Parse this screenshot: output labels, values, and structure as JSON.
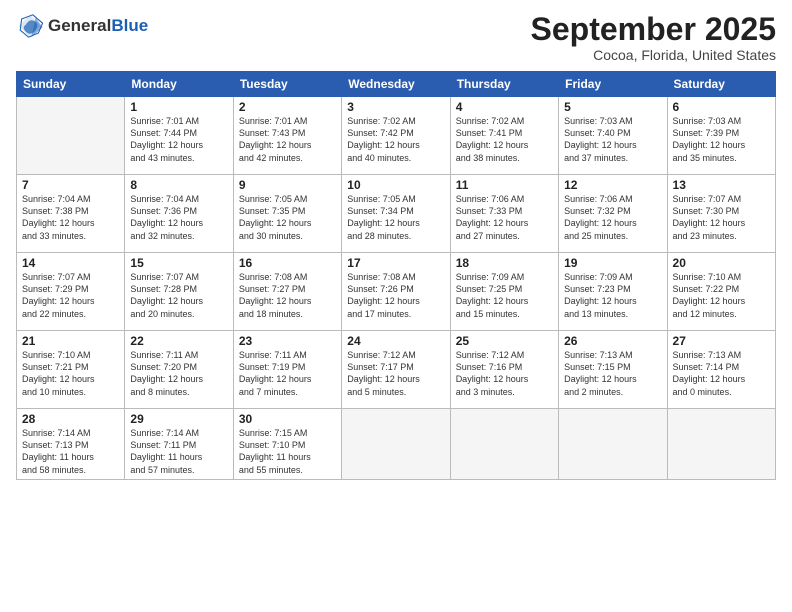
{
  "logo": {
    "general": "General",
    "blue": "Blue"
  },
  "header": {
    "month": "September 2025",
    "location": "Cocoa, Florida, United States"
  },
  "weekdays": [
    "Sunday",
    "Monday",
    "Tuesday",
    "Wednesday",
    "Thursday",
    "Friday",
    "Saturday"
  ],
  "weeks": [
    [
      {
        "day": "",
        "info": ""
      },
      {
        "day": "1",
        "info": "Sunrise: 7:01 AM\nSunset: 7:44 PM\nDaylight: 12 hours\nand 43 minutes."
      },
      {
        "day": "2",
        "info": "Sunrise: 7:01 AM\nSunset: 7:43 PM\nDaylight: 12 hours\nand 42 minutes."
      },
      {
        "day": "3",
        "info": "Sunrise: 7:02 AM\nSunset: 7:42 PM\nDaylight: 12 hours\nand 40 minutes."
      },
      {
        "day": "4",
        "info": "Sunrise: 7:02 AM\nSunset: 7:41 PM\nDaylight: 12 hours\nand 38 minutes."
      },
      {
        "day": "5",
        "info": "Sunrise: 7:03 AM\nSunset: 7:40 PM\nDaylight: 12 hours\nand 37 minutes."
      },
      {
        "day": "6",
        "info": "Sunrise: 7:03 AM\nSunset: 7:39 PM\nDaylight: 12 hours\nand 35 minutes."
      }
    ],
    [
      {
        "day": "7",
        "info": "Sunrise: 7:04 AM\nSunset: 7:38 PM\nDaylight: 12 hours\nand 33 minutes."
      },
      {
        "day": "8",
        "info": "Sunrise: 7:04 AM\nSunset: 7:36 PM\nDaylight: 12 hours\nand 32 minutes."
      },
      {
        "day": "9",
        "info": "Sunrise: 7:05 AM\nSunset: 7:35 PM\nDaylight: 12 hours\nand 30 minutes."
      },
      {
        "day": "10",
        "info": "Sunrise: 7:05 AM\nSunset: 7:34 PM\nDaylight: 12 hours\nand 28 minutes."
      },
      {
        "day": "11",
        "info": "Sunrise: 7:06 AM\nSunset: 7:33 PM\nDaylight: 12 hours\nand 27 minutes."
      },
      {
        "day": "12",
        "info": "Sunrise: 7:06 AM\nSunset: 7:32 PM\nDaylight: 12 hours\nand 25 minutes."
      },
      {
        "day": "13",
        "info": "Sunrise: 7:07 AM\nSunset: 7:30 PM\nDaylight: 12 hours\nand 23 minutes."
      }
    ],
    [
      {
        "day": "14",
        "info": "Sunrise: 7:07 AM\nSunset: 7:29 PM\nDaylight: 12 hours\nand 22 minutes."
      },
      {
        "day": "15",
        "info": "Sunrise: 7:07 AM\nSunset: 7:28 PM\nDaylight: 12 hours\nand 20 minutes."
      },
      {
        "day": "16",
        "info": "Sunrise: 7:08 AM\nSunset: 7:27 PM\nDaylight: 12 hours\nand 18 minutes."
      },
      {
        "day": "17",
        "info": "Sunrise: 7:08 AM\nSunset: 7:26 PM\nDaylight: 12 hours\nand 17 minutes."
      },
      {
        "day": "18",
        "info": "Sunrise: 7:09 AM\nSunset: 7:25 PM\nDaylight: 12 hours\nand 15 minutes."
      },
      {
        "day": "19",
        "info": "Sunrise: 7:09 AM\nSunset: 7:23 PM\nDaylight: 12 hours\nand 13 minutes."
      },
      {
        "day": "20",
        "info": "Sunrise: 7:10 AM\nSunset: 7:22 PM\nDaylight: 12 hours\nand 12 minutes."
      }
    ],
    [
      {
        "day": "21",
        "info": "Sunrise: 7:10 AM\nSunset: 7:21 PM\nDaylight: 12 hours\nand 10 minutes."
      },
      {
        "day": "22",
        "info": "Sunrise: 7:11 AM\nSunset: 7:20 PM\nDaylight: 12 hours\nand 8 minutes."
      },
      {
        "day": "23",
        "info": "Sunrise: 7:11 AM\nSunset: 7:19 PM\nDaylight: 12 hours\nand 7 minutes."
      },
      {
        "day": "24",
        "info": "Sunrise: 7:12 AM\nSunset: 7:17 PM\nDaylight: 12 hours\nand 5 minutes."
      },
      {
        "day": "25",
        "info": "Sunrise: 7:12 AM\nSunset: 7:16 PM\nDaylight: 12 hours\nand 3 minutes."
      },
      {
        "day": "26",
        "info": "Sunrise: 7:13 AM\nSunset: 7:15 PM\nDaylight: 12 hours\nand 2 minutes."
      },
      {
        "day": "27",
        "info": "Sunrise: 7:13 AM\nSunset: 7:14 PM\nDaylight: 12 hours\nand 0 minutes."
      }
    ],
    [
      {
        "day": "28",
        "info": "Sunrise: 7:14 AM\nSunset: 7:13 PM\nDaylight: 11 hours\nand 58 minutes."
      },
      {
        "day": "29",
        "info": "Sunrise: 7:14 AM\nSunset: 7:11 PM\nDaylight: 11 hours\nand 57 minutes."
      },
      {
        "day": "30",
        "info": "Sunrise: 7:15 AM\nSunset: 7:10 PM\nDaylight: 11 hours\nand 55 minutes."
      },
      {
        "day": "",
        "info": ""
      },
      {
        "day": "",
        "info": ""
      },
      {
        "day": "",
        "info": ""
      },
      {
        "day": "",
        "info": ""
      }
    ]
  ]
}
